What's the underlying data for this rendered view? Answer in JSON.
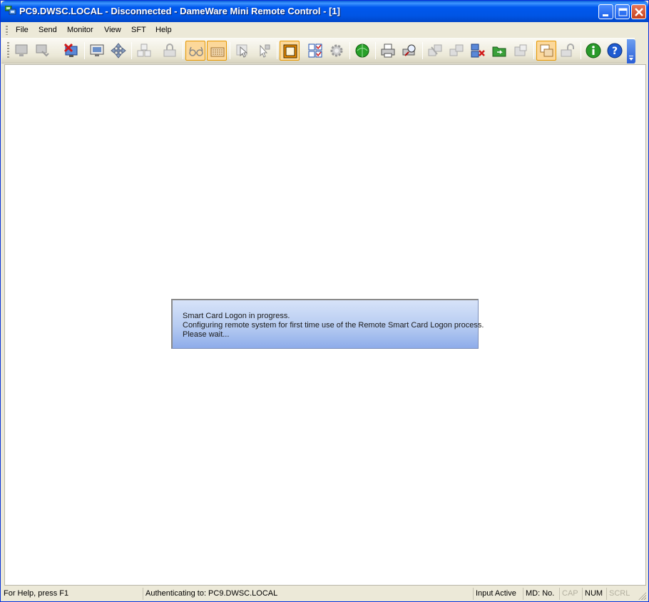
{
  "window": {
    "title": "PC9.DWSC.LOCAL - Disconnected - DameWare Mini Remote Control - [1]",
    "accent": "#0055e5"
  },
  "titlebar_buttons": [
    "minimize-icon",
    "maximize-icon",
    "close-icon"
  ],
  "menu": {
    "items": [
      "File",
      "Send",
      "Monitor",
      "View",
      "SFT",
      "Help"
    ]
  },
  "toolbar": {
    "tools": [
      {
        "icon": "remote-computer-icon",
        "enabled": false
      },
      {
        "icon": "connect-dropdown-icon",
        "enabled": false
      },
      {
        "icon": "disconnect-icon",
        "enabled": true
      },
      {
        "icon": "display-settings-icon",
        "enabled": true
      },
      {
        "icon": "move-icon",
        "enabled": true
      },
      {
        "icon": "send-keys-icon",
        "enabled": false
      },
      {
        "icon": "lock-keyboard-icon",
        "enabled": false
      },
      {
        "icon": "view-only-icon",
        "enabled": true,
        "active": true
      },
      {
        "icon": "keyboard-icon",
        "enabled": true,
        "active": true
      },
      {
        "icon": "select-cursor-icon",
        "enabled": false
      },
      {
        "icon": "pointer-icon",
        "enabled": false
      },
      {
        "icon": "full-screen-icon",
        "enabled": true,
        "active": true
      },
      {
        "icon": "multi-monitor-icon",
        "enabled": true
      },
      {
        "icon": "settings-gear-icon",
        "enabled": false
      },
      {
        "icon": "chat-globe-icon",
        "enabled": true
      },
      {
        "icon": "print-icon",
        "enabled": true
      },
      {
        "icon": "print-preview-icon",
        "enabled": true
      },
      {
        "icon": "file-transfer-icon",
        "enabled": false
      },
      {
        "icon": "copy-icon",
        "enabled": false
      },
      {
        "icon": "network-disconnect-icon",
        "enabled": true
      },
      {
        "icon": "folder-sync-icon",
        "enabled": true
      },
      {
        "icon": "properties-icon",
        "enabled": false
      },
      {
        "icon": "window-overlap-icon",
        "enabled": true,
        "active": true
      },
      {
        "icon": "unlock-icon",
        "enabled": false
      },
      {
        "icon": "info-icon",
        "enabled": true
      },
      {
        "icon": "help-icon",
        "enabled": true
      }
    ]
  },
  "message": {
    "lines": [
      "Smart Card Logon in progress.",
      "Configuring remote system for first time use of the Remote Smart Card Logon process.",
      "Please wait..."
    ]
  },
  "status": {
    "help": "For Help, press F1",
    "auth": "Authenticating to: PC9.DWSC.LOCAL",
    "input": "Input Active",
    "md": "MD: No.",
    "cap": "CAP",
    "num": "NUM",
    "scrl": "SCRL"
  }
}
